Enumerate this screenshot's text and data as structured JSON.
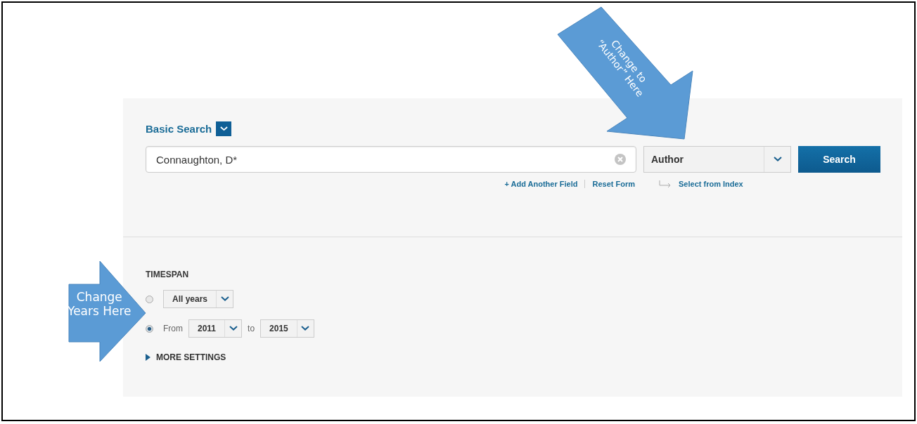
{
  "search": {
    "title": "Basic Search",
    "query": "Connaughton, D*",
    "field": "Author",
    "button": "Search",
    "links": [
      "+ Add Another Field",
      "Reset Form"
    ],
    "index_link": "Select from Index"
  },
  "timespan": {
    "heading": "TIMESPAN",
    "options": [
      {
        "kind": "preset",
        "selected": false,
        "value": "All years"
      },
      {
        "kind": "range",
        "selected": true,
        "from_label": "From",
        "from": "2011",
        "to_label": "to",
        "to": "2015"
      }
    ],
    "more": "MORE SETTINGS"
  },
  "callouts": [
    {
      "kind": "diagonal",
      "lines": [
        "Change to",
        "“Author” Here"
      ]
    },
    {
      "kind": "right",
      "lines": [
        "Change",
        "Years Here"
      ]
    }
  ]
}
